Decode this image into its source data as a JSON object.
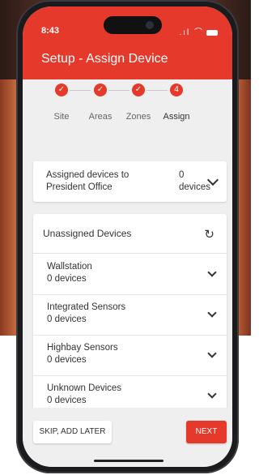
{
  "status_bar": {
    "time": "8:43",
    "icons": ".ıl ⌒"
  },
  "header": {
    "title": "Setup - Assign Device"
  },
  "steps": [
    {
      "label": "Site",
      "state": "done",
      "mark": "✓"
    },
    {
      "label": "Areas",
      "state": "done",
      "mark": "✓"
    },
    {
      "label": "Zones",
      "state": "done",
      "mark": "✓"
    },
    {
      "label": "Assign",
      "state": "active",
      "mark": "4"
    }
  ],
  "assigned": {
    "label": "Assigned devices to President Office",
    "count": "0 devices"
  },
  "unassigned": {
    "title": "Unassigned Devices",
    "items": [
      {
        "name": "Wallstation",
        "count": "0 devices"
      },
      {
        "name": "Integrated Sensors",
        "count": "0 devices"
      },
      {
        "name": "Highbay Sensors",
        "count": "0 devices"
      },
      {
        "name": "Unknown Devices",
        "count": "0 devices"
      }
    ]
  },
  "footer": {
    "skip_label": "SKIP, ADD LATER",
    "next_label": "NEXT"
  },
  "colors": {
    "accent": "#e53a2b",
    "background": "#efefef"
  },
  "icons": {
    "refresh": "refresh-icon",
    "chevron": "chevron-down-icon",
    "check": "check-icon"
  }
}
